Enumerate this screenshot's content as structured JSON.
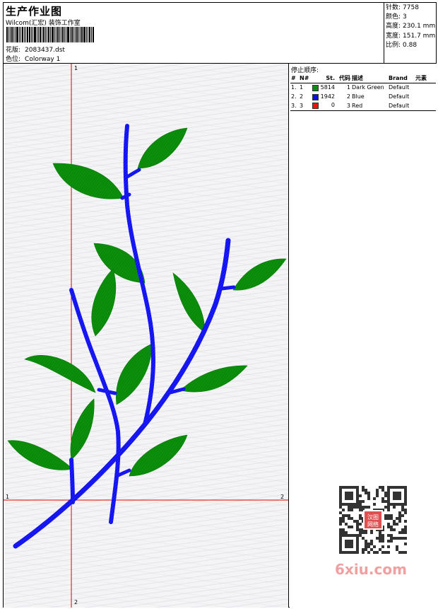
{
  "header": {
    "title": "生产作业图",
    "company": "Wilcom(汇宏) 装饰工作室",
    "design_label": "花版:",
    "design_value": "2083437.dst",
    "colorway_label": "色位:",
    "colorway_value": "Colorway 1"
  },
  "stats": {
    "stitches_label": "针数:",
    "stitches_value": "7758",
    "colors_label": "颜色:",
    "colors_value": "3",
    "height_label": "高度:",
    "height_value": "230.1 mm",
    "width_label": "宽度:",
    "width_value": "151.7 mm",
    "scale_label": "比例:",
    "scale_value": "0.88"
  },
  "design": {
    "axis_h_left": "1",
    "axis_h_right": "2",
    "axis_v_top": "1",
    "axis_v_bottom": "2",
    "stem_color": "#1a1aff",
    "leaf_color": "#0a8a0a",
    "crosshair_color": "#e00000"
  },
  "sequence": {
    "title": "停止顺序:",
    "headers": [
      "#",
      "N#",
      "St.",
      "代码",
      "描述",
      "Brand",
      "元素"
    ],
    "rows": [
      {
        "idx": "1.",
        "n": "1",
        "color": "#118811",
        "stitches": "5814",
        "code": "1",
        "desc": "Dark Green",
        "brand": "Default",
        "elem": ""
      },
      {
        "idx": "2.",
        "n": "2",
        "color": "#1111dd",
        "stitches": "1942",
        "code": "2",
        "desc": "Blue",
        "brand": "Default",
        "elem": ""
      },
      {
        "idx": "3.",
        "n": "3",
        "color": "#ee1111",
        "stitches": "0",
        "code": "3",
        "desc": "Red",
        "brand": "Default",
        "elem": ""
      }
    ]
  },
  "watermark": {
    "seal_top": "汉图",
    "seal_bottom": "网络",
    "site": "6xiu.com"
  }
}
